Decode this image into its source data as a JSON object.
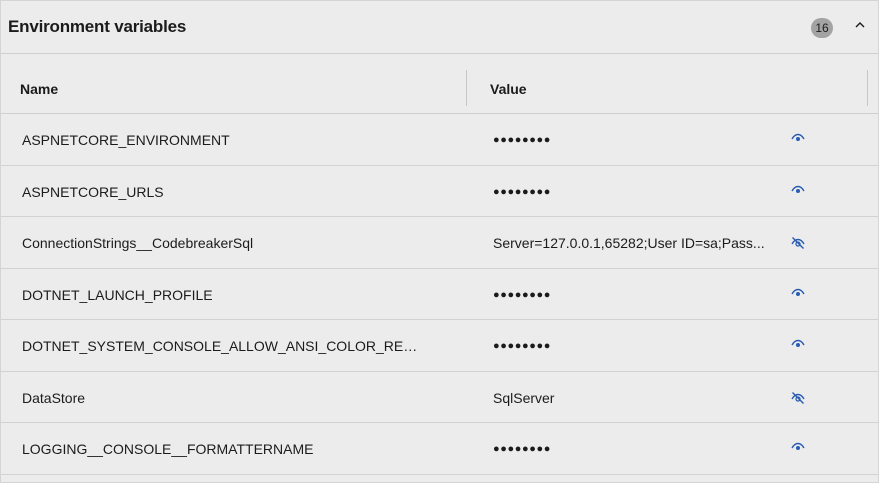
{
  "panel": {
    "title": "Environment variables",
    "count": "16"
  },
  "columns": {
    "name": "Name",
    "value": "Value"
  },
  "colors": {
    "accent": "#2a5db0"
  },
  "rows": [
    {
      "name": "ASPNETCORE_ENVIRONMENT",
      "value": "●●●●●●●●",
      "masked": true,
      "icon": "eye-icon"
    },
    {
      "name": "ASPNETCORE_URLS",
      "value": "●●●●●●●●",
      "masked": true,
      "icon": "eye-icon"
    },
    {
      "name": "ConnectionStrings__CodebreakerSql",
      "value": "Server=127.0.0.1,65282;User ID=sa;Pass...",
      "masked": false,
      "icon": "eye-slash-icon"
    },
    {
      "name": "DOTNET_LAUNCH_PROFILE",
      "value": "●●●●●●●●",
      "masked": true,
      "icon": "eye-icon"
    },
    {
      "name": "DOTNET_SYSTEM_CONSOLE_ALLOW_ANSI_COLOR_REDI...",
      "value": "●●●●●●●●",
      "masked": true,
      "icon": "eye-icon"
    },
    {
      "name": "DataStore",
      "value": "SqlServer",
      "masked": false,
      "icon": "eye-slash-icon"
    },
    {
      "name": "LOGGING__CONSOLE__FORMATTERNAME",
      "value": "●●●●●●●●",
      "masked": true,
      "icon": "eye-icon"
    }
  ]
}
